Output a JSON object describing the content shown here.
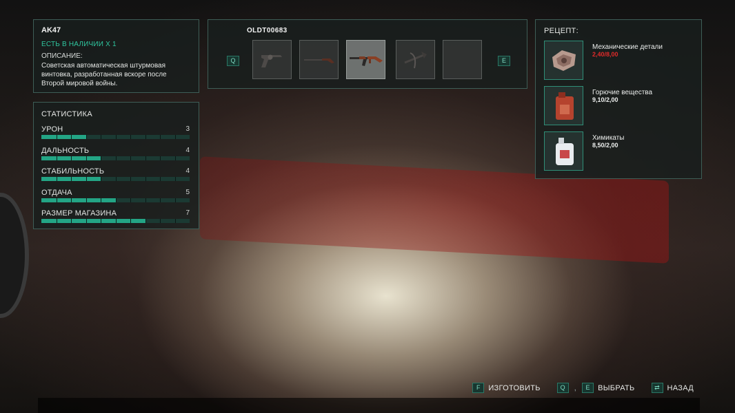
{
  "weapon": {
    "name": "AK47",
    "availability": "ЕСТЬ В НАЛИЧИИ X 1",
    "description_label": "ОПИСАНИЕ:",
    "description": "Советская автоматическая штурмовая винтовка, разработанная вскоре после Второй мировой войны."
  },
  "stats": {
    "title": "СТАТИСТИКА",
    "max": 10,
    "items": [
      {
        "label": "УРОН",
        "value": "3"
      },
      {
        "label": "ДАЛЬНОСТЬ",
        "value": "4"
      },
      {
        "label": "СТАБИЛЬНОСТЬ",
        "value": "4"
      },
      {
        "label": "ОТДАЧА",
        "value": "5"
      },
      {
        "label": "РАЗМЕР МАГАЗИНА",
        "value": "7"
      }
    ]
  },
  "carousel": {
    "code": "OLDT00683",
    "prev_key": "Q",
    "next_key": "E",
    "selected_index": 2,
    "slots": [
      {
        "item": "revolver-icon"
      },
      {
        "item": "shotgun-icon"
      },
      {
        "item": "ak47-rifle-icon"
      },
      {
        "item": "crossbow-icon"
      },
      {
        "item": "empty-slot"
      }
    ]
  },
  "recipe": {
    "title": "РЕЦЕПТ:",
    "ingredients": [
      {
        "name": "Механические детали",
        "qty": "2,40/8,00",
        "insufficient": true,
        "icon": "mechanical-parts-icon"
      },
      {
        "name": "Горючие вещества",
        "qty": "9,10/2,00",
        "insufficient": false,
        "icon": "fuel-canister-icon"
      },
      {
        "name": "Химикаты",
        "qty": "8,50/2,00",
        "insufficient": false,
        "icon": "chemicals-jug-icon"
      }
    ]
  },
  "controls": {
    "craft_key": "F",
    "craft_label": "ИЗГОТОВИТЬ",
    "select_key_1": "Q",
    "select_sep": ",",
    "select_key_2": "E",
    "select_label": "ВЫБРАТЬ",
    "back_key": "⇄",
    "back_label": "НАЗАД"
  },
  "colors": {
    "accent": "#23a585",
    "panel_border": "#3e5e57",
    "insufficient": "#e02a2a"
  }
}
